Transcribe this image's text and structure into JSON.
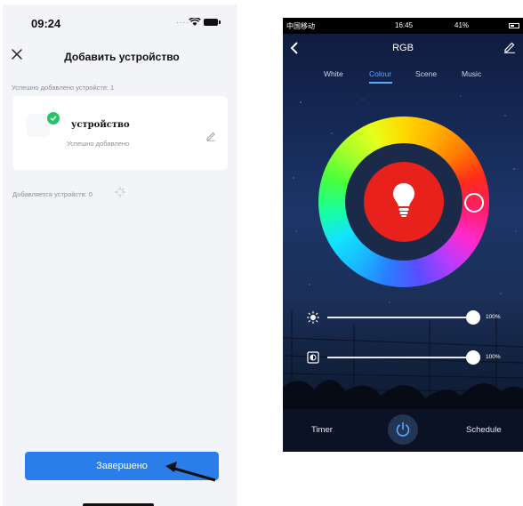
{
  "left_screen": {
    "status_bar": {
      "time": "09:24",
      "dots": "...."
    },
    "header": {
      "title": "Добавить устройство"
    },
    "success_count": "Успешно добавлено устройств: 1",
    "device": {
      "name": "устройство",
      "status": "Успешно добавлено"
    },
    "adding_count": "Добавляется устройств: 0",
    "done_button": "Завершено",
    "colors": {
      "accent": "#2b7de9",
      "success": "#27c26b"
    }
  },
  "right_screen": {
    "status_bar": {
      "carrier": "中国移动",
      "time": "16:45",
      "status": "41%"
    },
    "header": {
      "title": "RGB"
    },
    "tabs": [
      {
        "label": "White",
        "active": false
      },
      {
        "label": "Colour",
        "active": true
      },
      {
        "label": "Scene",
        "active": false
      },
      {
        "label": "Music",
        "active": false
      }
    ],
    "brightness": {
      "value": 1.0,
      "label": "100%"
    },
    "saturation": {
      "value": 1.0,
      "label": "100%"
    },
    "bottom": {
      "timer": "Timer",
      "schedule": "Schedule"
    },
    "colors": {
      "selected": "#e8211c",
      "accent": "#5aa9ff"
    }
  }
}
